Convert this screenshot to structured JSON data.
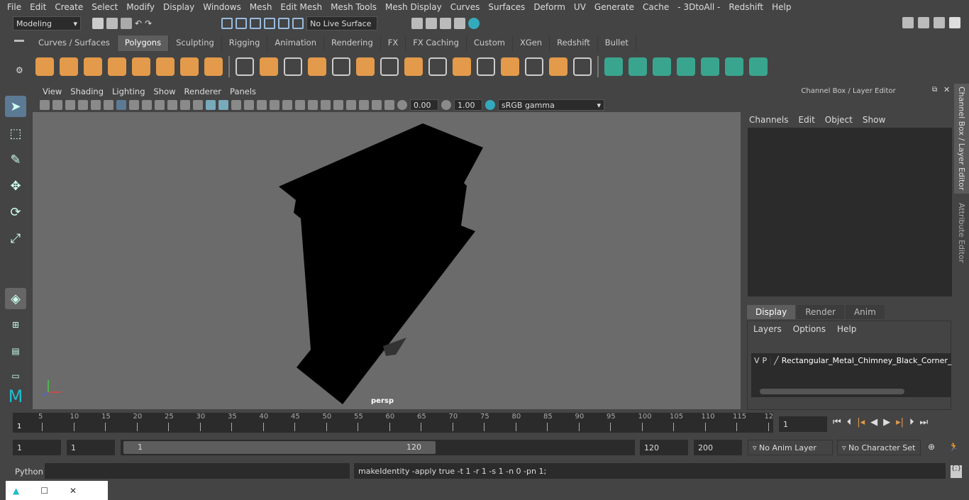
{
  "menu": [
    "File",
    "Edit",
    "Create",
    "Select",
    "Modify",
    "Display",
    "Windows",
    "Mesh",
    "Edit Mesh",
    "Mesh Tools",
    "Mesh Display",
    "Curves",
    "Surfaces",
    "Deform",
    "UV",
    "Generate",
    "Cache",
    "- 3DtoAll -",
    "Redshift",
    "Help"
  ],
  "mode_selector": "Modeling",
  "live_surface": "No Live Surface",
  "shelf_tabs": [
    "Curves / Surfaces",
    "Polygons",
    "Sculpting",
    "Rigging",
    "Animation",
    "Rendering",
    "FX",
    "FX Caching",
    "Custom",
    "XGen",
    "Redshift",
    "Bullet"
  ],
  "active_shelf_tab": "Polygons",
  "viewport_menu": [
    "View",
    "Shading",
    "Lighting",
    "Show",
    "Renderer",
    "Panels"
  ],
  "viewport_toolbar": {
    "exposure": "0.00",
    "gamma": "1.00",
    "color_space": "sRGB gamma"
  },
  "camera_label": "persp",
  "channel_box": {
    "title": "Channel Box / Layer Editor",
    "menu": [
      "Channels",
      "Edit",
      "Object",
      "Show"
    ]
  },
  "layer_editor": {
    "tabs": [
      "Display",
      "Render",
      "Anim"
    ],
    "active_tab": "Display",
    "menu": [
      "Layers",
      "Options",
      "Help"
    ],
    "layer": {
      "v": "V",
      "p": "P",
      "name": "Rectangular_Metal_Chimney_Black_Corner_"
    }
  },
  "side_tabs": [
    "Channel Box / Layer Editor",
    "Attribute Editor"
  ],
  "timeline": {
    "ticks": [
      "5",
      "10",
      "15",
      "20",
      "25",
      "30",
      "35",
      "40",
      "45",
      "50",
      "55",
      "60",
      "65",
      "70",
      "75",
      "80",
      "85",
      "90",
      "95",
      "100",
      "105",
      "110",
      "115",
      "12"
    ],
    "current_frame_marker": "1",
    "current_frame": "1"
  },
  "range": {
    "start": "1",
    "playback_start": "1",
    "slider_start": "1",
    "slider_end": "120",
    "playback_end": "120",
    "end": "200",
    "anim_layer": "No Anim Layer",
    "character_set": "No Character Set"
  },
  "command": {
    "language": "Python",
    "output": "makeIdentity -apply true -t 1 -r 1 -s 1 -n 0 -pn 1;"
  },
  "accent": "#e39a4a"
}
